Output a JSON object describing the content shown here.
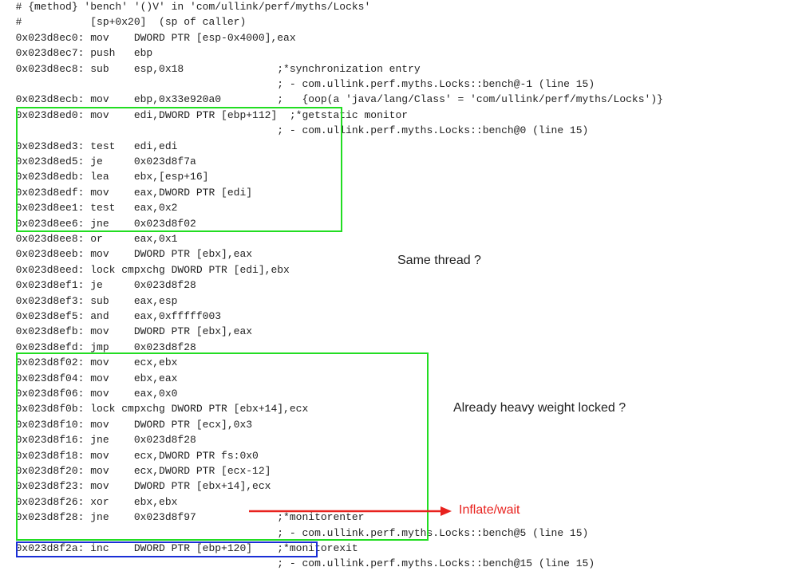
{
  "listing": [
    "  # {method} 'bench' '()V' in 'com/ullink/perf/myths/Locks'",
    "  #           [sp+0x20]  (sp of caller)",
    "  0x023d8ec0: mov    DWORD PTR [esp-0x4000],eax",
    "  0x023d8ec7: push   ebp",
    "  0x023d8ec8: sub    esp,0x18               ;*synchronization entry",
    "                                            ; - com.ullink.perf.myths.Locks::bench@-1 (line 15)",
    "  0x023d8ecb: mov    ebp,0x33e920a0         ;   {oop(a 'java/lang/Class' = 'com/ullink/perf/myths/Locks')}",
    "  0x023d8ed0: mov    edi,DWORD PTR [ebp+112]  ;*getstatic monitor",
    "                                            ; - com.ullink.perf.myths.Locks::bench@0 (line 15)",
    "  0x023d8ed3: test   edi,edi",
    "  0x023d8ed5: je     0x023d8f7a",
    "  0x023d8edb: lea    ebx,[esp+16]",
    "  0x023d8edf: mov    eax,DWORD PTR [edi]",
    "  0x023d8ee1: test   eax,0x2",
    "  0x023d8ee6: jne    0x023d8f02",
    "  0x023d8ee8: or     eax,0x1",
    "  0x023d8eeb: mov    DWORD PTR [ebx],eax",
    "  0x023d8eed: lock cmpxchg DWORD PTR [edi],ebx",
    "  0x023d8ef1: je     0x023d8f28",
    "  0x023d8ef3: sub    eax,esp",
    "  0x023d8ef5: and    eax,0xfffff003",
    "  0x023d8efb: mov    DWORD PTR [ebx],eax",
    "  0x023d8efd: jmp    0x023d8f28",
    "  0x023d8f02: mov    ecx,ebx",
    "  0x023d8f04: mov    ebx,eax",
    "  0x023d8f06: mov    eax,0x0",
    "  0x023d8f0b: lock cmpxchg DWORD PTR [ebx+14],ecx",
    "  0x023d8f10: mov    DWORD PTR [ecx],0x3",
    "  0x023d8f16: jne    0x023d8f28",
    "  0x023d8f18: mov    ecx,DWORD PTR fs:0x0",
    "  0x023d8f20: mov    ecx,DWORD PTR [ecx-12]",
    "  0x023d8f23: mov    DWORD PTR [ebx+14],ecx",
    "  0x023d8f26: xor    ebx,ebx",
    "  0x023d8f28: jne    0x023d8f97             ;*monitorenter",
    "                                            ; - com.ullink.perf.myths.Locks::bench@5 (line 15)",
    "  0x023d8f2a: inc    DWORD PTR [ebp+120]    ;*monitorexit",
    "                                            ; - com.ullink.perf.myths.Locks::bench@15 (line 15)"
  ],
  "annotations": {
    "same_thread": "Same thread ?",
    "heavy_weight": "Already heavy weight locked ?",
    "inflate_wait": "Inflate/wait"
  },
  "colors": {
    "green_box": "#22dd22",
    "blue_box": "#1a2fd6",
    "arrow": "#e8221e",
    "text": "#222222"
  }
}
